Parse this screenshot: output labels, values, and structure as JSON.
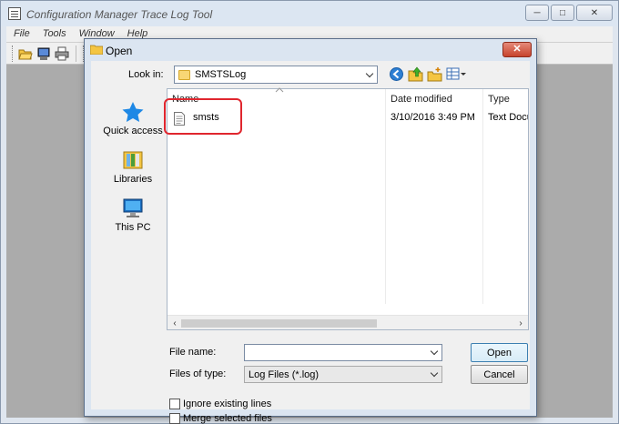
{
  "app": {
    "title": "Configuration Manager Trace Log Tool",
    "menu": [
      "File",
      "Tools",
      "Window",
      "Help"
    ],
    "window_buttons": {
      "minimize": "─",
      "maximize": "□",
      "close": "✕"
    }
  },
  "dialog": {
    "title": "Open",
    "close_glyph": "✕",
    "look_in_label": "Look in:",
    "look_in_value": "SMSTSLog",
    "places": [
      {
        "label": "Quick access",
        "icon": "quick-access-star-icon"
      },
      {
        "label": "Libraries",
        "icon": "libraries-icon"
      },
      {
        "label": "This PC",
        "icon": "this-pc-icon"
      }
    ],
    "columns": [
      "Name",
      "Date modified",
      "Type"
    ],
    "files": [
      {
        "name": "smsts",
        "date_modified": "3/10/2016 3:49 PM",
        "type": "Text Docu..."
      }
    ],
    "file_name_label": "File name:",
    "file_name_value": "",
    "files_of_type_label": "Files of type:",
    "files_of_type_value": "Log Files (*.log)",
    "open_button": "Open",
    "cancel_button": "Cancel",
    "ignore_existing_lines": "Ignore existing lines",
    "merge_selected_files": "Merge selected files"
  },
  "colors": {
    "highlight": "#e0262e",
    "dialog_frame": "#dbe5f1",
    "client_area": "#ababab"
  }
}
